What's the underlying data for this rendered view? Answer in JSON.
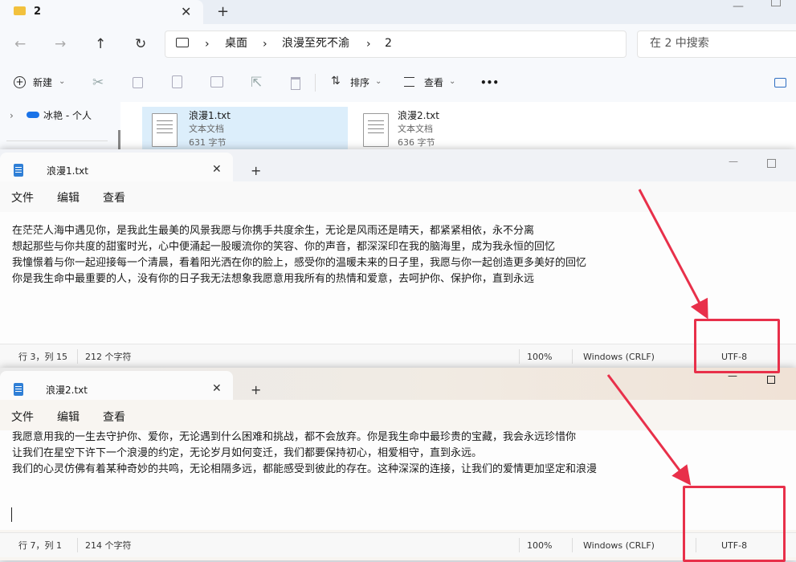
{
  "explorer": {
    "tab_title": "2",
    "address": [
      "桌面",
      "浪漫至死不渝",
      "2"
    ],
    "search_placeholder": "在 2 中搜索",
    "toolbar": {
      "new": "新建",
      "sort": "排序",
      "view": "查看",
      "more": "•••"
    },
    "nav": {
      "onedrive": "冰艳 - 个人"
    },
    "files": [
      {
        "name": "浪漫1.txt",
        "type": "文本文档",
        "size": "631 字节"
      },
      {
        "name": "浪漫2.txt",
        "type": "文本文档",
        "size": "636 字节"
      }
    ]
  },
  "notepad1": {
    "tab_title": "浪漫1.txt",
    "menu": [
      "文件",
      "编辑",
      "查看"
    ],
    "lines": [
      "在茫茫人海中遇见你，是我此生最美的风景我愿与你携手共度余生，无论是风雨还是晴天，都紧紧相依，永不分离",
      "想起那些与你共度的甜蜜时光，心中便涌起一股暖流你的笑容、你的声音，都深深印在我的脑海里，成为我永恒的回忆",
      "我憧憬着与你一起迎接每一个清晨，看着阳光洒在你的脸上，感受你的温暖未来的日子里，我愿与你一起创造更多美好的回忆",
      "你是我生命中最重要的人，没有你的日子我无法想象我愿意用我所有的热情和爱意，去呵护你、保护你，直到永远"
    ],
    "status": {
      "position": "行 3，列 15",
      "chars": "212 个字符",
      "zoom": "100%",
      "eol": "Windows (CRLF)",
      "encoding": "UTF-8"
    }
  },
  "notepad2": {
    "tab_title": "浪漫2.txt",
    "menu": [
      "文件",
      "编辑",
      "查看"
    ],
    "lines": [
      "我愿意用我的一生去守护你、爱你，无论遇到什么困难和挑战，都不会放弃。你是我生命中最珍贵的宝藏，我会永远珍惜你",
      "让我们在星空下许下一个浪漫的约定，无论岁月如何变迁，我们都要保持初心，相爱相守，直到永远。",
      "我们的心灵仿佛有着某种奇妙的共鸣，无论相隔多远，都能感受到彼此的存在。这种深深的连接，让我们的爱情更加坚定和浪漫"
    ],
    "status": {
      "position": "行 7，列 1",
      "chars": "214 个字符",
      "zoom": "100%",
      "eol": "Windows (CRLF)",
      "encoding": "UTF-8"
    }
  },
  "colors": {
    "highlight": "#e8304a",
    "accent": "#2f7fd6",
    "selection": "#dceefb"
  }
}
